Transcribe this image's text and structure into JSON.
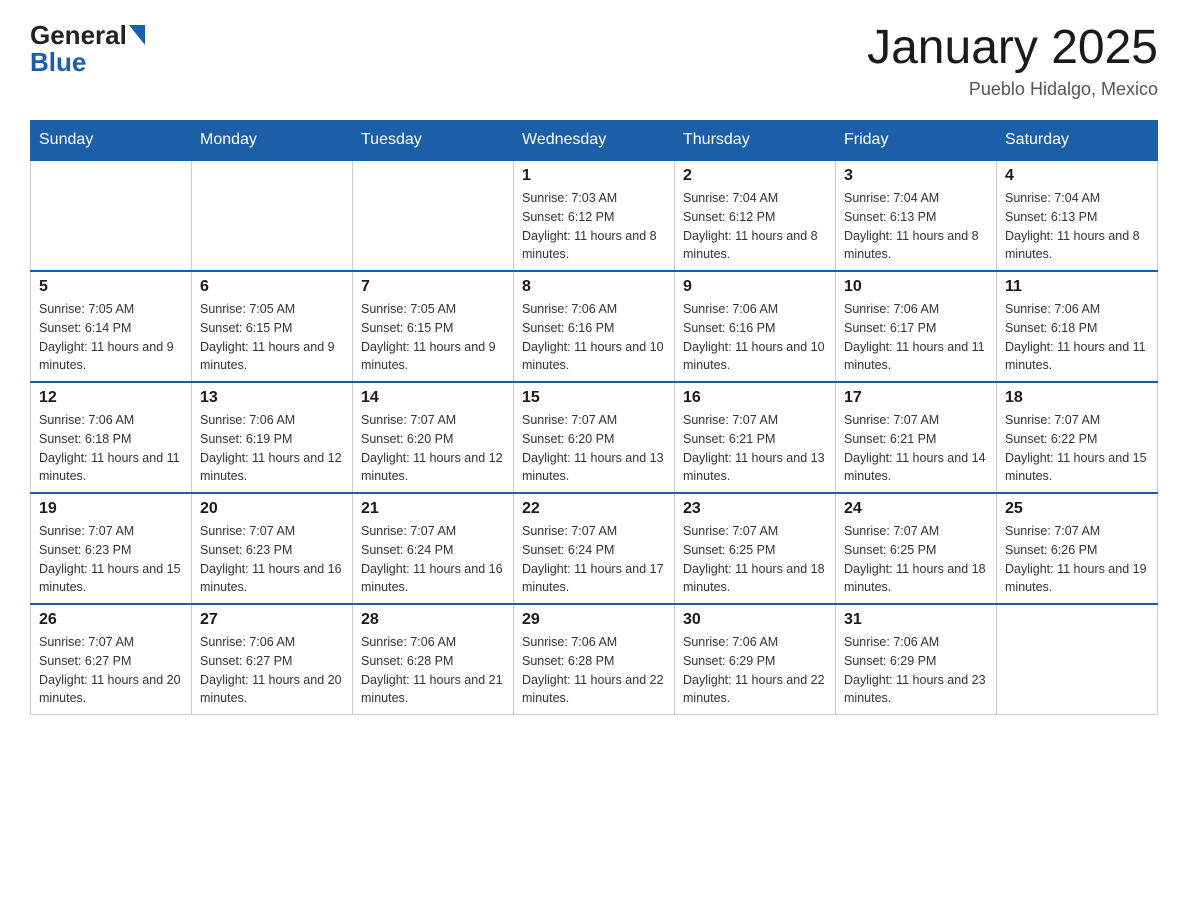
{
  "header": {
    "logo_general": "General",
    "logo_blue": "Blue",
    "title": "January 2025",
    "location": "Pueblo Hidalgo, Mexico"
  },
  "days_of_week": [
    "Sunday",
    "Monday",
    "Tuesday",
    "Wednesday",
    "Thursday",
    "Friday",
    "Saturday"
  ],
  "weeks": [
    [
      {
        "day": "",
        "info": ""
      },
      {
        "day": "",
        "info": ""
      },
      {
        "day": "",
        "info": ""
      },
      {
        "day": "1",
        "info": "Sunrise: 7:03 AM\nSunset: 6:12 PM\nDaylight: 11 hours and 8 minutes."
      },
      {
        "day": "2",
        "info": "Sunrise: 7:04 AM\nSunset: 6:12 PM\nDaylight: 11 hours and 8 minutes."
      },
      {
        "day": "3",
        "info": "Sunrise: 7:04 AM\nSunset: 6:13 PM\nDaylight: 11 hours and 8 minutes."
      },
      {
        "day": "4",
        "info": "Sunrise: 7:04 AM\nSunset: 6:13 PM\nDaylight: 11 hours and 8 minutes."
      }
    ],
    [
      {
        "day": "5",
        "info": "Sunrise: 7:05 AM\nSunset: 6:14 PM\nDaylight: 11 hours and 9 minutes."
      },
      {
        "day": "6",
        "info": "Sunrise: 7:05 AM\nSunset: 6:15 PM\nDaylight: 11 hours and 9 minutes."
      },
      {
        "day": "7",
        "info": "Sunrise: 7:05 AM\nSunset: 6:15 PM\nDaylight: 11 hours and 9 minutes."
      },
      {
        "day": "8",
        "info": "Sunrise: 7:06 AM\nSunset: 6:16 PM\nDaylight: 11 hours and 10 minutes."
      },
      {
        "day": "9",
        "info": "Sunrise: 7:06 AM\nSunset: 6:16 PM\nDaylight: 11 hours and 10 minutes."
      },
      {
        "day": "10",
        "info": "Sunrise: 7:06 AM\nSunset: 6:17 PM\nDaylight: 11 hours and 11 minutes."
      },
      {
        "day": "11",
        "info": "Sunrise: 7:06 AM\nSunset: 6:18 PM\nDaylight: 11 hours and 11 minutes."
      }
    ],
    [
      {
        "day": "12",
        "info": "Sunrise: 7:06 AM\nSunset: 6:18 PM\nDaylight: 11 hours and 11 minutes."
      },
      {
        "day": "13",
        "info": "Sunrise: 7:06 AM\nSunset: 6:19 PM\nDaylight: 11 hours and 12 minutes."
      },
      {
        "day": "14",
        "info": "Sunrise: 7:07 AM\nSunset: 6:20 PM\nDaylight: 11 hours and 12 minutes."
      },
      {
        "day": "15",
        "info": "Sunrise: 7:07 AM\nSunset: 6:20 PM\nDaylight: 11 hours and 13 minutes."
      },
      {
        "day": "16",
        "info": "Sunrise: 7:07 AM\nSunset: 6:21 PM\nDaylight: 11 hours and 13 minutes."
      },
      {
        "day": "17",
        "info": "Sunrise: 7:07 AM\nSunset: 6:21 PM\nDaylight: 11 hours and 14 minutes."
      },
      {
        "day": "18",
        "info": "Sunrise: 7:07 AM\nSunset: 6:22 PM\nDaylight: 11 hours and 15 minutes."
      }
    ],
    [
      {
        "day": "19",
        "info": "Sunrise: 7:07 AM\nSunset: 6:23 PM\nDaylight: 11 hours and 15 minutes."
      },
      {
        "day": "20",
        "info": "Sunrise: 7:07 AM\nSunset: 6:23 PM\nDaylight: 11 hours and 16 minutes."
      },
      {
        "day": "21",
        "info": "Sunrise: 7:07 AM\nSunset: 6:24 PM\nDaylight: 11 hours and 16 minutes."
      },
      {
        "day": "22",
        "info": "Sunrise: 7:07 AM\nSunset: 6:24 PM\nDaylight: 11 hours and 17 minutes."
      },
      {
        "day": "23",
        "info": "Sunrise: 7:07 AM\nSunset: 6:25 PM\nDaylight: 11 hours and 18 minutes."
      },
      {
        "day": "24",
        "info": "Sunrise: 7:07 AM\nSunset: 6:25 PM\nDaylight: 11 hours and 18 minutes."
      },
      {
        "day": "25",
        "info": "Sunrise: 7:07 AM\nSunset: 6:26 PM\nDaylight: 11 hours and 19 minutes."
      }
    ],
    [
      {
        "day": "26",
        "info": "Sunrise: 7:07 AM\nSunset: 6:27 PM\nDaylight: 11 hours and 20 minutes."
      },
      {
        "day": "27",
        "info": "Sunrise: 7:06 AM\nSunset: 6:27 PM\nDaylight: 11 hours and 20 minutes."
      },
      {
        "day": "28",
        "info": "Sunrise: 7:06 AM\nSunset: 6:28 PM\nDaylight: 11 hours and 21 minutes."
      },
      {
        "day": "29",
        "info": "Sunrise: 7:06 AM\nSunset: 6:28 PM\nDaylight: 11 hours and 22 minutes."
      },
      {
        "day": "30",
        "info": "Sunrise: 7:06 AM\nSunset: 6:29 PM\nDaylight: 11 hours and 22 minutes."
      },
      {
        "day": "31",
        "info": "Sunrise: 7:06 AM\nSunset: 6:29 PM\nDaylight: 11 hours and 23 minutes."
      },
      {
        "day": "",
        "info": ""
      }
    ]
  ]
}
